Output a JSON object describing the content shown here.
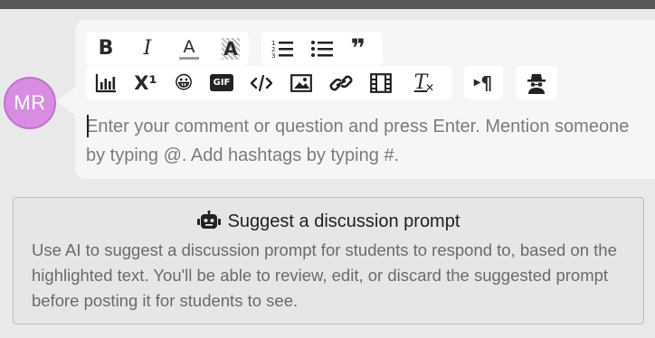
{
  "avatar": {
    "initials": "MR",
    "color": "#d88de2"
  },
  "toolbar": {
    "row1_group1": [
      {
        "name": "bold-icon",
        "label": "B"
      },
      {
        "name": "italic-icon",
        "label": "I"
      },
      {
        "name": "font-color-icon",
        "label": "A"
      },
      {
        "name": "highlight-icon",
        "label": "A"
      }
    ],
    "row1_group2": [
      {
        "name": "ordered-list-icon"
      },
      {
        "name": "bullet-list-icon"
      },
      {
        "name": "quote-icon",
        "label": "❞"
      }
    ],
    "row2_group1": [
      {
        "name": "chart-icon"
      },
      {
        "name": "superscript-icon",
        "label": "X¹"
      },
      {
        "name": "emoji-icon",
        "label": "😀"
      },
      {
        "name": "gif-icon",
        "label": "GIF"
      },
      {
        "name": "code-icon"
      },
      {
        "name": "image-icon"
      },
      {
        "name": "link-icon"
      },
      {
        "name": "video-icon"
      },
      {
        "name": "clear-format-icon",
        "label": "T"
      }
    ],
    "row2_group2": [
      {
        "name": "paragraph-direction-icon",
        "label": "¶"
      }
    ],
    "row2_group3": [
      {
        "name": "anonymous-icon"
      }
    ]
  },
  "editor": {
    "placeholder": "Enter your comment or question and press Enter. Mention someone by typing @. Add hashtags by typing #."
  },
  "suggest": {
    "title": "Suggest a discussion prompt",
    "description": "Use AI to suggest a discussion prompt for students to respond to, based on the highlighted text. You'll be able to review, edit, or discard the suggested prompt before posting it for students to see."
  }
}
